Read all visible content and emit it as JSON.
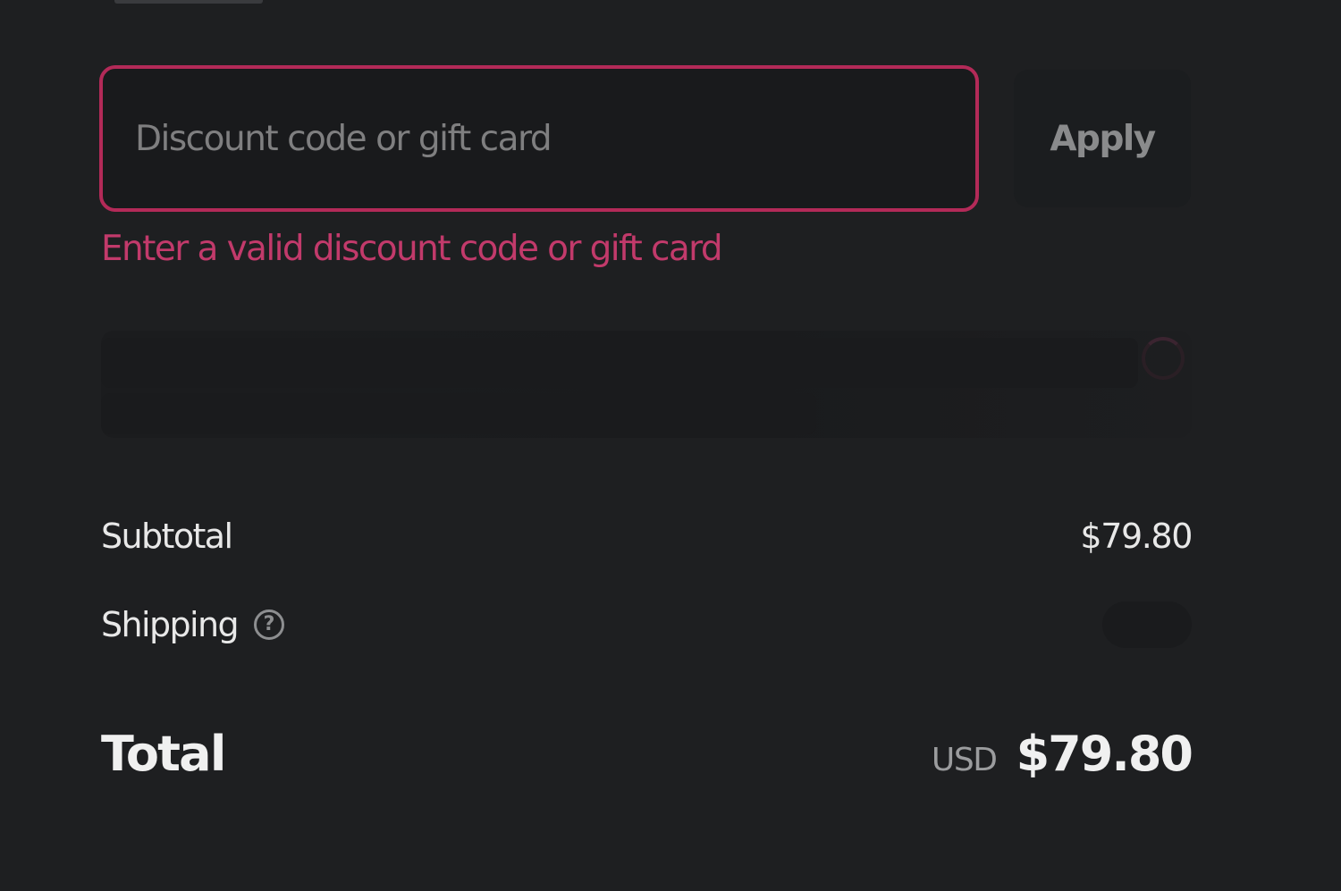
{
  "discount": {
    "value": "",
    "placeholder": "Discount code or gift card",
    "apply_label": "Apply",
    "error_message": "Enter a valid discount code or gift card"
  },
  "summary": {
    "subtotal_label": "Subtotal",
    "subtotal_value": "$79.80",
    "shipping_label": "Shipping",
    "help_icon": "?",
    "total_label": "Total",
    "currency": "USD",
    "total_value": "$79.80"
  },
  "colors": {
    "background": "#1e1f21",
    "error": "#c23a6b",
    "input_border_error": "#b32a58",
    "text_primary": "#e8e8e8",
    "text_muted": "#8a8b8c"
  }
}
